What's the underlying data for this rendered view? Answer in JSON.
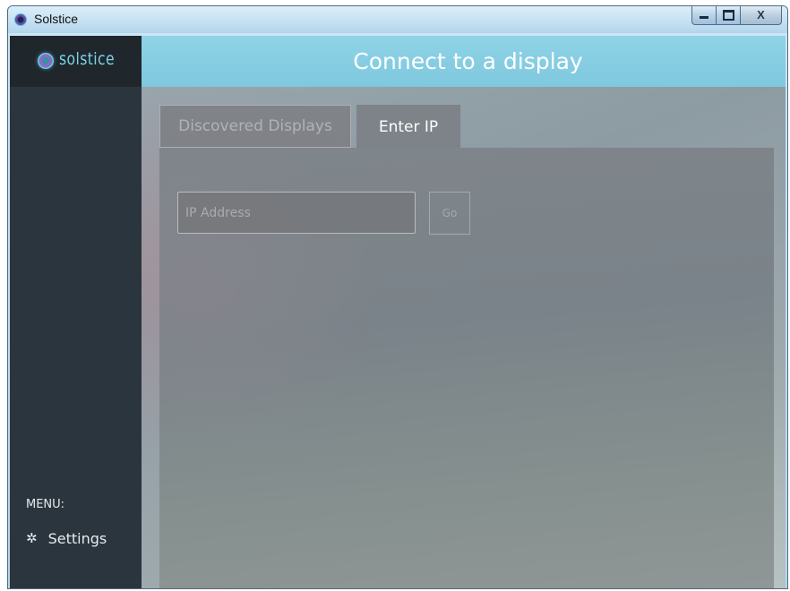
{
  "window": {
    "title": "Solstice",
    "controls": {
      "minimize": "minimize",
      "maximize": "maximize",
      "close": "X"
    }
  },
  "sidebar": {
    "logo_text": "solstice",
    "menu_label": "MENU:",
    "items": [
      {
        "label": "Settings",
        "icon": "gear-icon"
      }
    ]
  },
  "header": {
    "title": "Connect to a display"
  },
  "tabs": [
    {
      "label": "Discovered Displays",
      "active": false
    },
    {
      "label": "Enter IP",
      "active": true
    }
  ],
  "form": {
    "ip_placeholder": "IP Address",
    "ip_value": "",
    "go_label": "Go"
  },
  "colors": {
    "header_accent": "#8fd3e6",
    "sidebar_bg": "#2b353d",
    "logo_accent": "#7fd2e6"
  }
}
